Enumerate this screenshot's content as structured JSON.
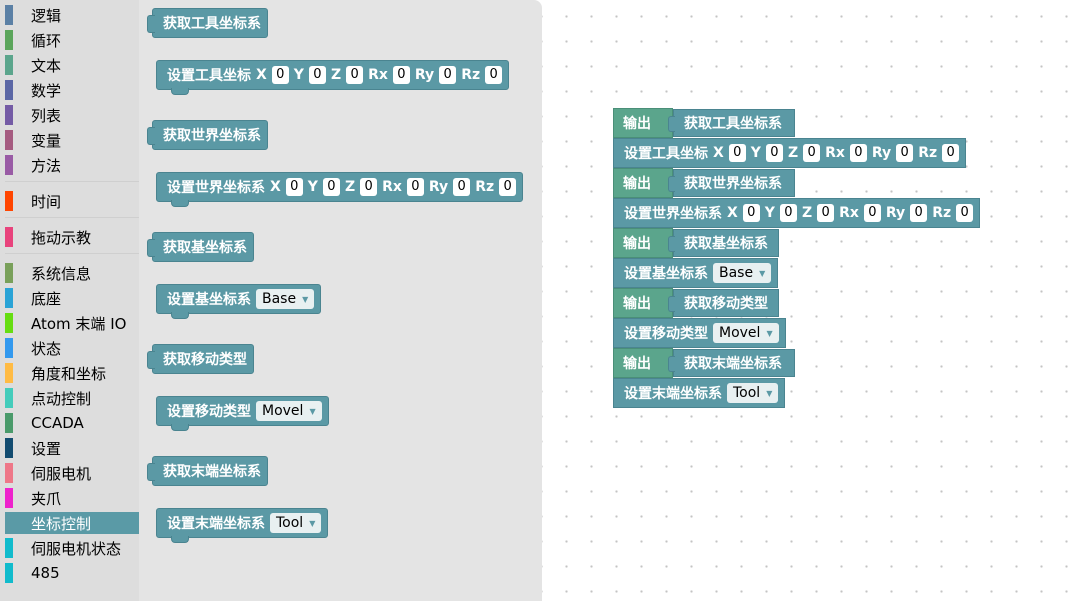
{
  "categories": [
    {
      "label": "逻辑",
      "color": "#5b80a5"
    },
    {
      "label": "循环",
      "color": "#5ba55b"
    },
    {
      "label": "文本",
      "color": "#5ba58c"
    },
    {
      "label": "数学",
      "color": "#5b67a5"
    },
    {
      "label": "列表",
      "color": "#745ba5"
    },
    {
      "label": "变量",
      "color": "#a55b80"
    },
    {
      "label": "方法",
      "color": "#995ba5"
    },
    {
      "label": "时间",
      "color": "#ff4500"
    },
    {
      "label": "拖动示教",
      "color": "#e8437c"
    },
    {
      "label": "系统信息",
      "color": "#79a05a"
    },
    {
      "label": "底座",
      "color": "#2aa3d6"
    },
    {
      "label": "Atom 末端 IO",
      "color": "#66dd11"
    },
    {
      "label": "状态",
      "color": "#3399ee"
    },
    {
      "label": "角度和坐标",
      "color": "#ffbb44"
    },
    {
      "label": "点动控制",
      "color": "#44ccbb"
    },
    {
      "label": "CCADA",
      "color": "#4a9a6a"
    },
    {
      "label": "设置",
      "color": "#134c70"
    },
    {
      "label": "伺服电机",
      "color": "#ee7788"
    },
    {
      "label": "夹爪",
      "color": "#ee22cc"
    },
    {
      "label": "坐标控制",
      "color": "#5a9aa6",
      "selected": true
    },
    {
      "label": "伺服电机状态",
      "color": "#11bbcc"
    },
    {
      "label": "485",
      "color": "#11bbcc"
    }
  ],
  "flyout": {
    "get_tool": "获取工具坐标系",
    "set_tool": {
      "label": "设置工具坐标",
      "fields": [
        {
          "k": "X",
          "v": "0"
        },
        {
          "k": "Y",
          "v": "0"
        },
        {
          "k": "Z",
          "v": "0"
        },
        {
          "k": "Rx",
          "v": "0"
        },
        {
          "k": "Ry",
          "v": "0"
        },
        {
          "k": "Rz",
          "v": "0"
        }
      ]
    },
    "get_world": "获取世界坐标系",
    "set_world": {
      "label": "设置世界坐标系",
      "fields": [
        {
          "k": "X",
          "v": "0"
        },
        {
          "k": "Y",
          "v": "0"
        },
        {
          "k": "Z",
          "v": "0"
        },
        {
          "k": "Rx",
          "v": "0"
        },
        {
          "k": "Ry",
          "v": "0"
        },
        {
          "k": "Rz",
          "v": "0"
        }
      ]
    },
    "get_base": "获取基坐标系",
    "set_base": {
      "label": "设置基坐标系",
      "value": "Base"
    },
    "get_move": "获取移动类型",
    "set_move": {
      "label": "设置移动类型",
      "value": "Movel"
    },
    "get_end": "获取末端坐标系",
    "set_end": {
      "label": "设置末端坐标系",
      "value": "Tool"
    }
  },
  "workspace": {
    "output_label": "输出",
    "get_tool": "获取工具坐标系",
    "set_tool": {
      "label": "设置工具坐标",
      "fields": [
        {
          "k": "X",
          "v": "0"
        },
        {
          "k": "Y",
          "v": "0"
        },
        {
          "k": "Z",
          "v": "0"
        },
        {
          "k": "Rx",
          "v": "0"
        },
        {
          "k": "Ry",
          "v": "0"
        },
        {
          "k": "Rz",
          "v": "0"
        }
      ]
    },
    "get_world": "获取世界坐标系",
    "set_world": {
      "label": "设置世界坐标系",
      "fields": [
        {
          "k": "X",
          "v": "0"
        },
        {
          "k": "Y",
          "v": "0"
        },
        {
          "k": "Z",
          "v": "0"
        },
        {
          "k": "Rx",
          "v": "0"
        },
        {
          "k": "Ry",
          "v": "0"
        },
        {
          "k": "Rz",
          "v": "0"
        }
      ]
    },
    "get_base": "获取基坐标系",
    "set_base": {
      "label": "设置基坐标系",
      "value": "Base"
    },
    "get_move": "获取移动类型",
    "set_move": {
      "label": "设置移动类型",
      "value": "Movel"
    },
    "get_end": "获取末端坐标系",
    "set_end": {
      "label": "设置末端坐标系",
      "value": "Tool"
    }
  }
}
